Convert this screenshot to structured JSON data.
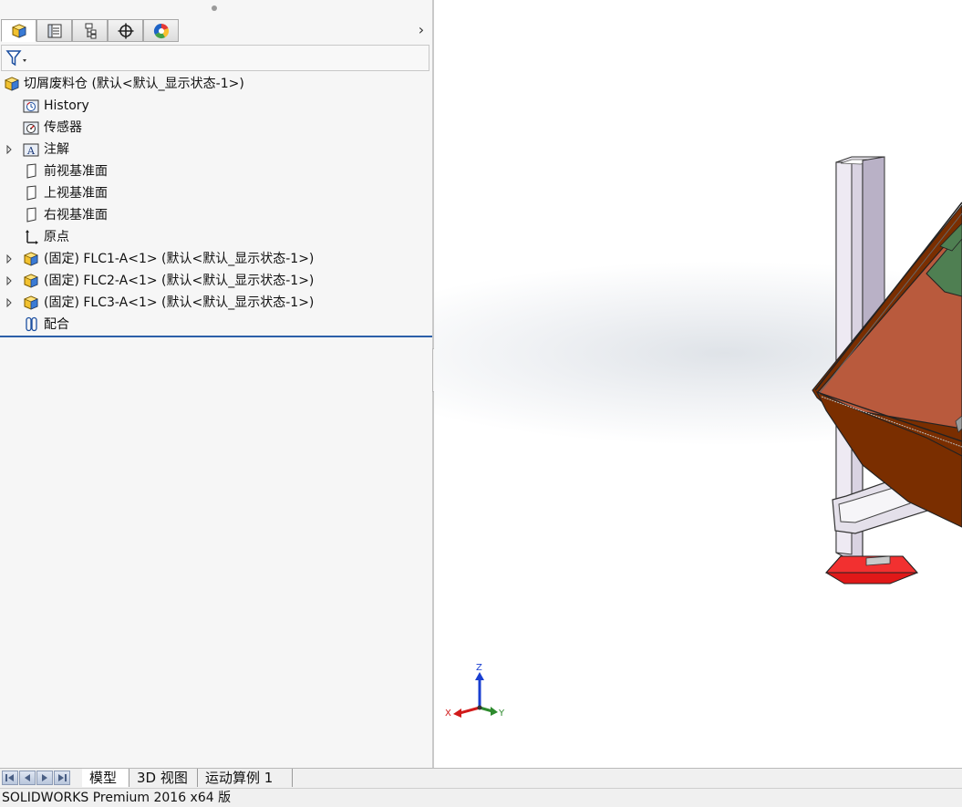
{
  "feature_manager": {
    "tabs": [
      {
        "name": "feature-manager-tab",
        "icon": "feature-tree-icon"
      },
      {
        "name": "property-manager-tab",
        "icon": "property-list-icon"
      },
      {
        "name": "configuration-manager-tab",
        "icon": "configuration-icon"
      },
      {
        "name": "dimxpert-manager-tab",
        "icon": "crosshair-icon"
      },
      {
        "name": "display-manager-tab",
        "icon": "color-wheel-icon"
      }
    ],
    "more_tabs_glyph": "›",
    "tree": {
      "root": "切屑废料仓 (默认<默认_显示状态-1>)",
      "items": [
        {
          "label": "History",
          "icon": "history-folder-icon",
          "expandable": false
        },
        {
          "label": "传感器",
          "icon": "sensor-folder-icon",
          "expandable": false
        },
        {
          "label": "注解",
          "icon": "annotation-folder-icon",
          "expandable": true
        },
        {
          "label": "前视基准面",
          "icon": "plane-icon",
          "expandable": false
        },
        {
          "label": "上视基准面",
          "icon": "plane-icon",
          "expandable": false
        },
        {
          "label": "右视基准面",
          "icon": "plane-icon",
          "expandable": false
        },
        {
          "label": "原点",
          "icon": "origin-icon",
          "expandable": false
        },
        {
          "label": "(固定) FLC1-A<1> (默认<默认_显示状态-1>)",
          "icon": "part-icon",
          "expandable": true
        },
        {
          "label": "(固定) FLC2-A<1> (默认<默认_显示状态-1>)",
          "icon": "part-icon",
          "expandable": true
        },
        {
          "label": "(固定) FLC3-A<1> (默认<默认_显示状态-1>)",
          "icon": "part-icon",
          "expandable": true
        },
        {
          "label": "配合",
          "icon": "mates-icon",
          "expandable": false
        }
      ]
    }
  },
  "triad": {
    "z": "Z",
    "x": "X",
    "y": "Y"
  },
  "bottom_tabs": [
    {
      "label": "模型",
      "active": true
    },
    {
      "label": "3D 视图",
      "active": false
    },
    {
      "label": "运动算例 1",
      "active": false
    }
  ],
  "status_bar": {
    "text": "SOLIDWORKS Premium 2016 x64 版"
  },
  "colors": {
    "accent_line": "#2c5fa8",
    "hopper_front": "#b95a3d",
    "hopper_bottom": "#7a2e00",
    "hopper_green": "#4f7f52",
    "foot": "#e01818",
    "frame": "#d8d2e0"
  }
}
